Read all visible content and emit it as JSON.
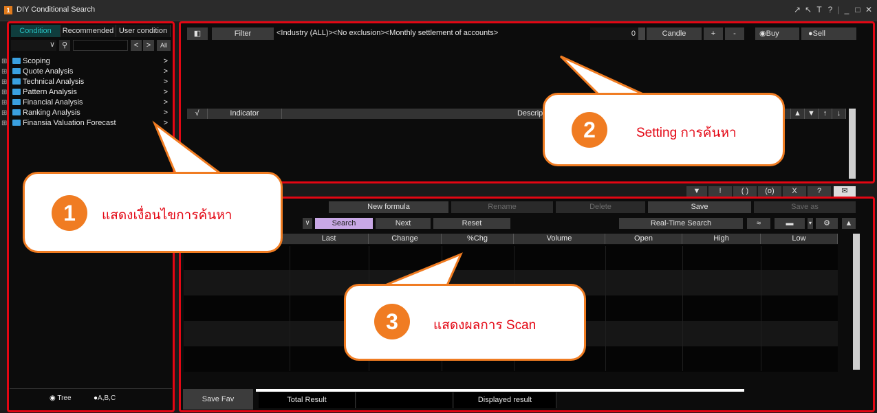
{
  "window": {
    "title": "DIY Conditional Search",
    "icon_text": "1"
  },
  "window_controls": [
    "↗",
    "↖",
    "T",
    "?",
    "|",
    "_",
    "□",
    "✕"
  ],
  "left_panel": {
    "tabs": [
      "Condition",
      "Recommended",
      "User condition"
    ],
    "toolbar": {
      "dropdown": "∨",
      "search": "🔍",
      "prev": "<",
      "next": ">",
      "all": "All"
    },
    "tree": [
      "Scoping",
      "Quote Analysis",
      "Technical Analysis",
      "Pattern Analysis",
      "Financial Analysis",
      "Ranking Analysis",
      "Finansia Valuation Forecast"
    ],
    "view_options": {
      "tree": "Tree",
      "abc": "A,B,C"
    }
  },
  "setting_panel": {
    "filter_label": "Filter",
    "filter_text": "<Industry (ALL)><No exclusion><Monthly settlement of accounts>",
    "count": "0",
    "candle": "Candle",
    "plus": "+",
    "minus": "-",
    "buy": "Buy",
    "sell": "Sell",
    "table_headers": [
      "√",
      "Indicator",
      "Description"
    ],
    "sort_buttons": [
      "▲",
      "▼",
      "↑",
      "↓"
    ],
    "logic_buttons": [
      "▼",
      "!",
      "( )",
      "(o)",
      "X",
      "?"
    ]
  },
  "formula_bar": {
    "new_formula": "New formula",
    "rename": "Rename",
    "delete": "Delete",
    "save": "Save",
    "save_as": "Save as",
    "search": "Search",
    "next": "Next",
    "reset": "Reset",
    "realtime": "Real-Time Search"
  },
  "results": {
    "columns": [
      "Last",
      "Change",
      "%Chg",
      "Volume",
      "Open",
      "High",
      "Low"
    ],
    "save_fav": "Save Fav",
    "total_result": "Total Result",
    "displayed_result": "Displayed result"
  },
  "callouts": [
    {
      "number": "1",
      "text": "แสดงเงื่อนไขการค้นหา"
    },
    {
      "number": "2",
      "text": "Setting การค้นหา"
    },
    {
      "number": "3",
      "text": "แสดงผลการ Scan"
    }
  ],
  "colors": {
    "highlight": "#e30613",
    "callout_border": "#f07c22",
    "active_tab": "#27c0c0",
    "search_button": "#c9a8e6"
  }
}
